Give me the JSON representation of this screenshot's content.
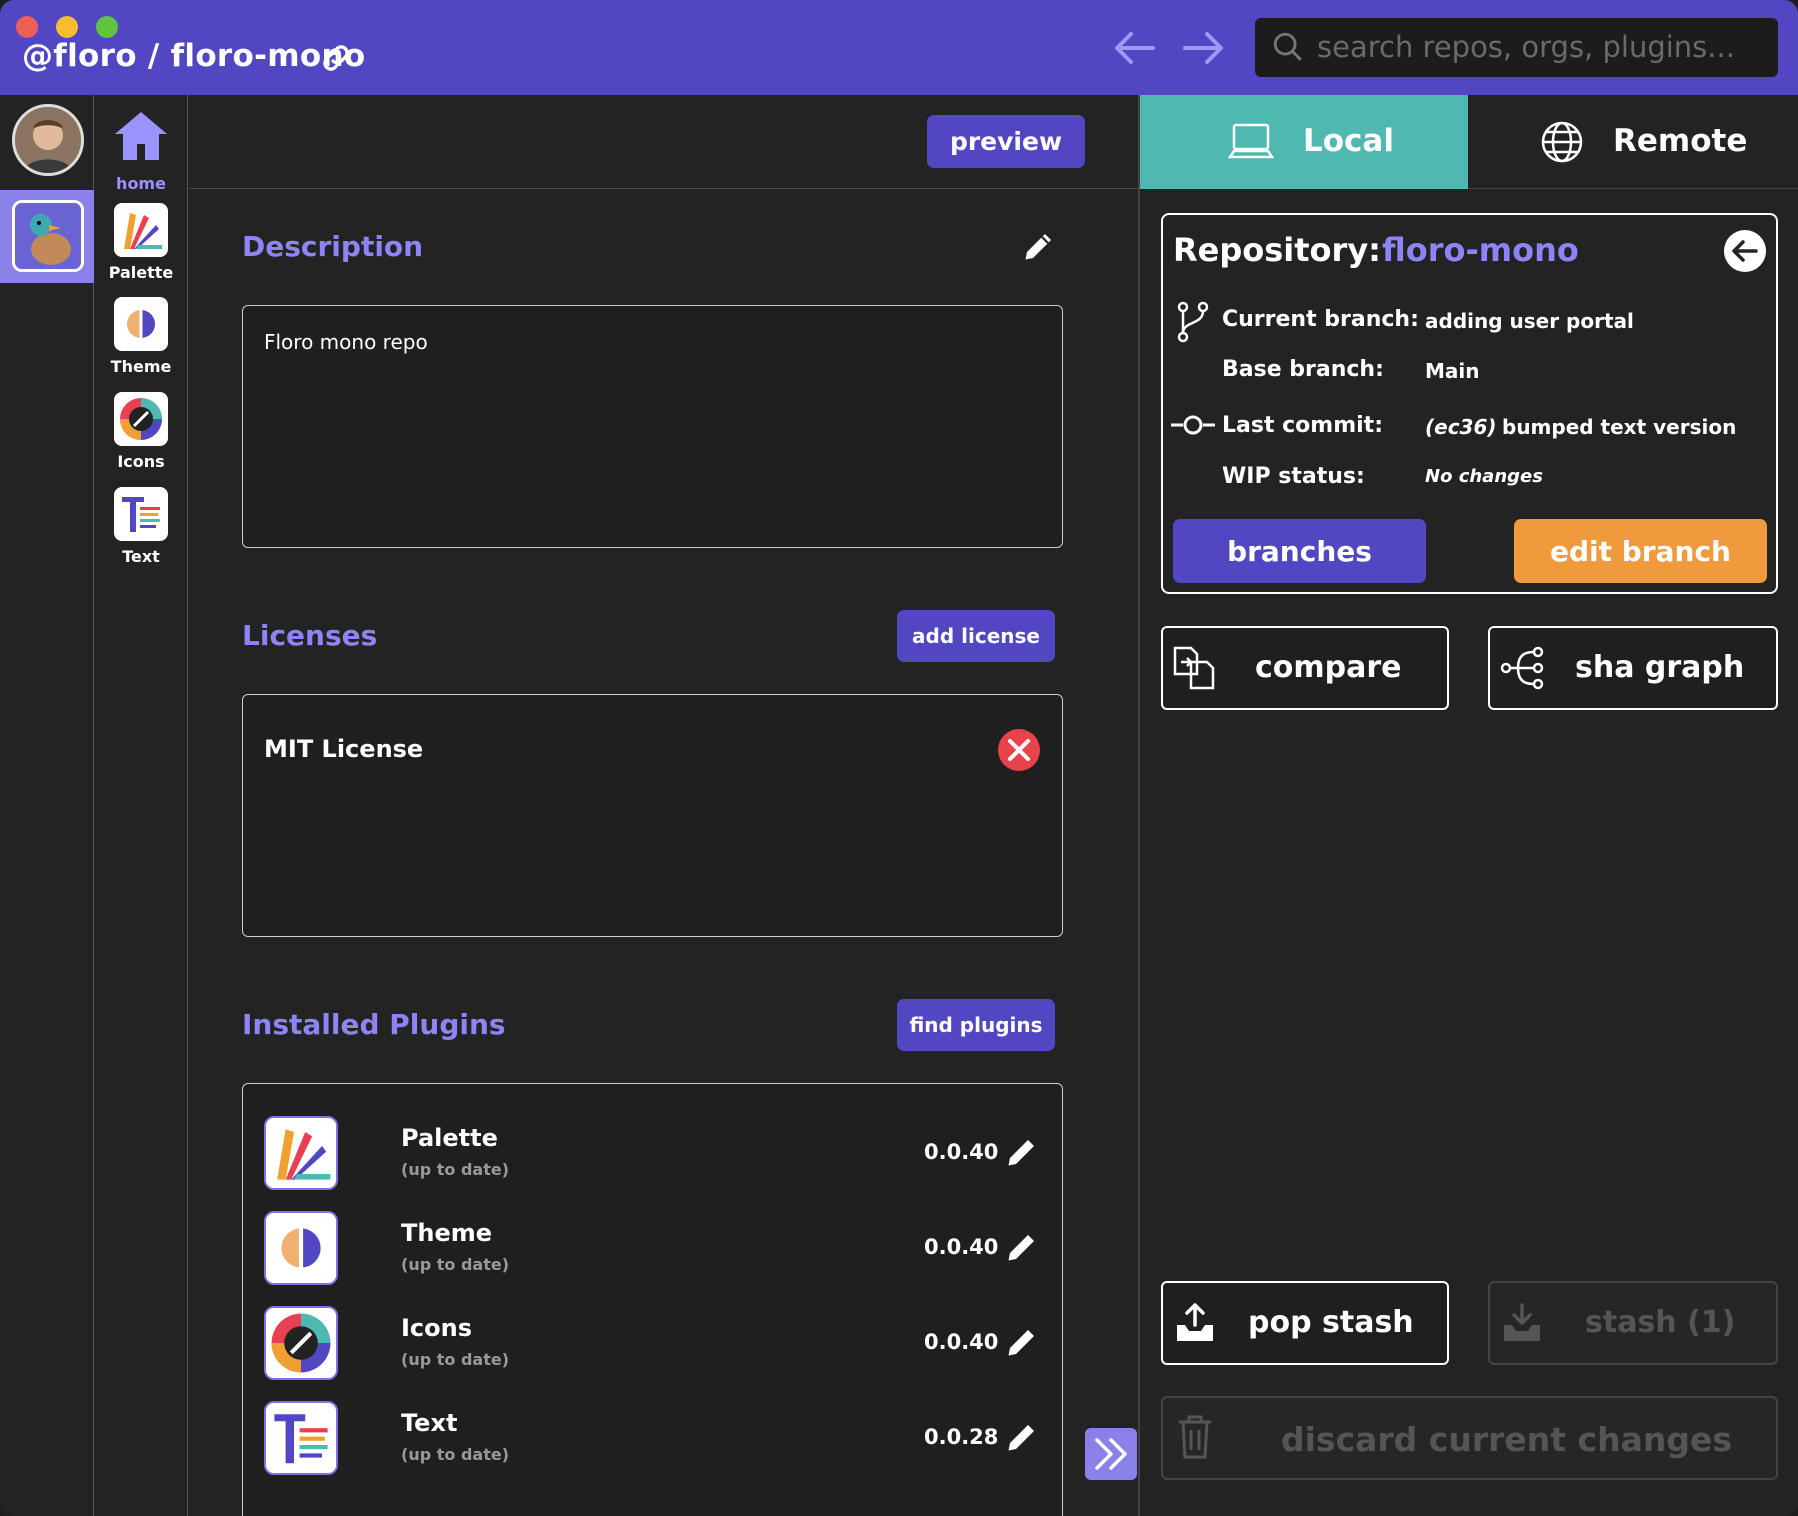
{
  "titlebar": {
    "title": "@floro / floro-mono",
    "search_placeholder": "search repos, orgs, plugins..."
  },
  "rail": {
    "home_label": "home"
  },
  "plugins_nav": [
    {
      "label": "Palette"
    },
    {
      "label": "Theme"
    },
    {
      "label": "Icons"
    },
    {
      "label": "Text"
    }
  ],
  "main": {
    "preview_label": "preview",
    "description_title": "Description",
    "description_text": "Floro mono repo",
    "licenses_title": "Licenses",
    "add_license_label": "add license",
    "license_name": "MIT License",
    "installed_title": "Installed Plugins",
    "find_plugins_label": "find plugins",
    "installed": [
      {
        "name": "Palette",
        "status": "(up to date)",
        "version": "0.0.40"
      },
      {
        "name": "Theme",
        "status": "(up to date)",
        "version": "0.0.40"
      },
      {
        "name": "Icons",
        "status": "(up to date)",
        "version": "0.0.40"
      },
      {
        "name": "Text",
        "status": "(up to date)",
        "version": "0.0.28"
      }
    ]
  },
  "tabs": {
    "local": "Local",
    "remote": "Remote"
  },
  "repo": {
    "label": "Repository:",
    "name": "floro-mono",
    "current_branch_key": "Current branch:",
    "current_branch": "adding user portal",
    "base_branch_key": "Base branch:",
    "base_branch": "Main",
    "last_commit_key": "Last commit:",
    "last_commit_sha": "(ec36)",
    "last_commit_msg": "bumped text version",
    "wip_key": "WIP status:",
    "wip": "No changes",
    "branches_label": "branches",
    "edit_branch_label": "edit branch"
  },
  "actions": {
    "compare": "compare",
    "sha_graph": "sha graph",
    "pop_stash": "pop stash",
    "stash": "stash (1)",
    "discard": "discard current changes"
  },
  "colors": {
    "accent": "#5147c2",
    "local_tab": "#4fb8b0",
    "edit_branch": "#ef9a3c",
    "section_title": "#8d84f5"
  }
}
